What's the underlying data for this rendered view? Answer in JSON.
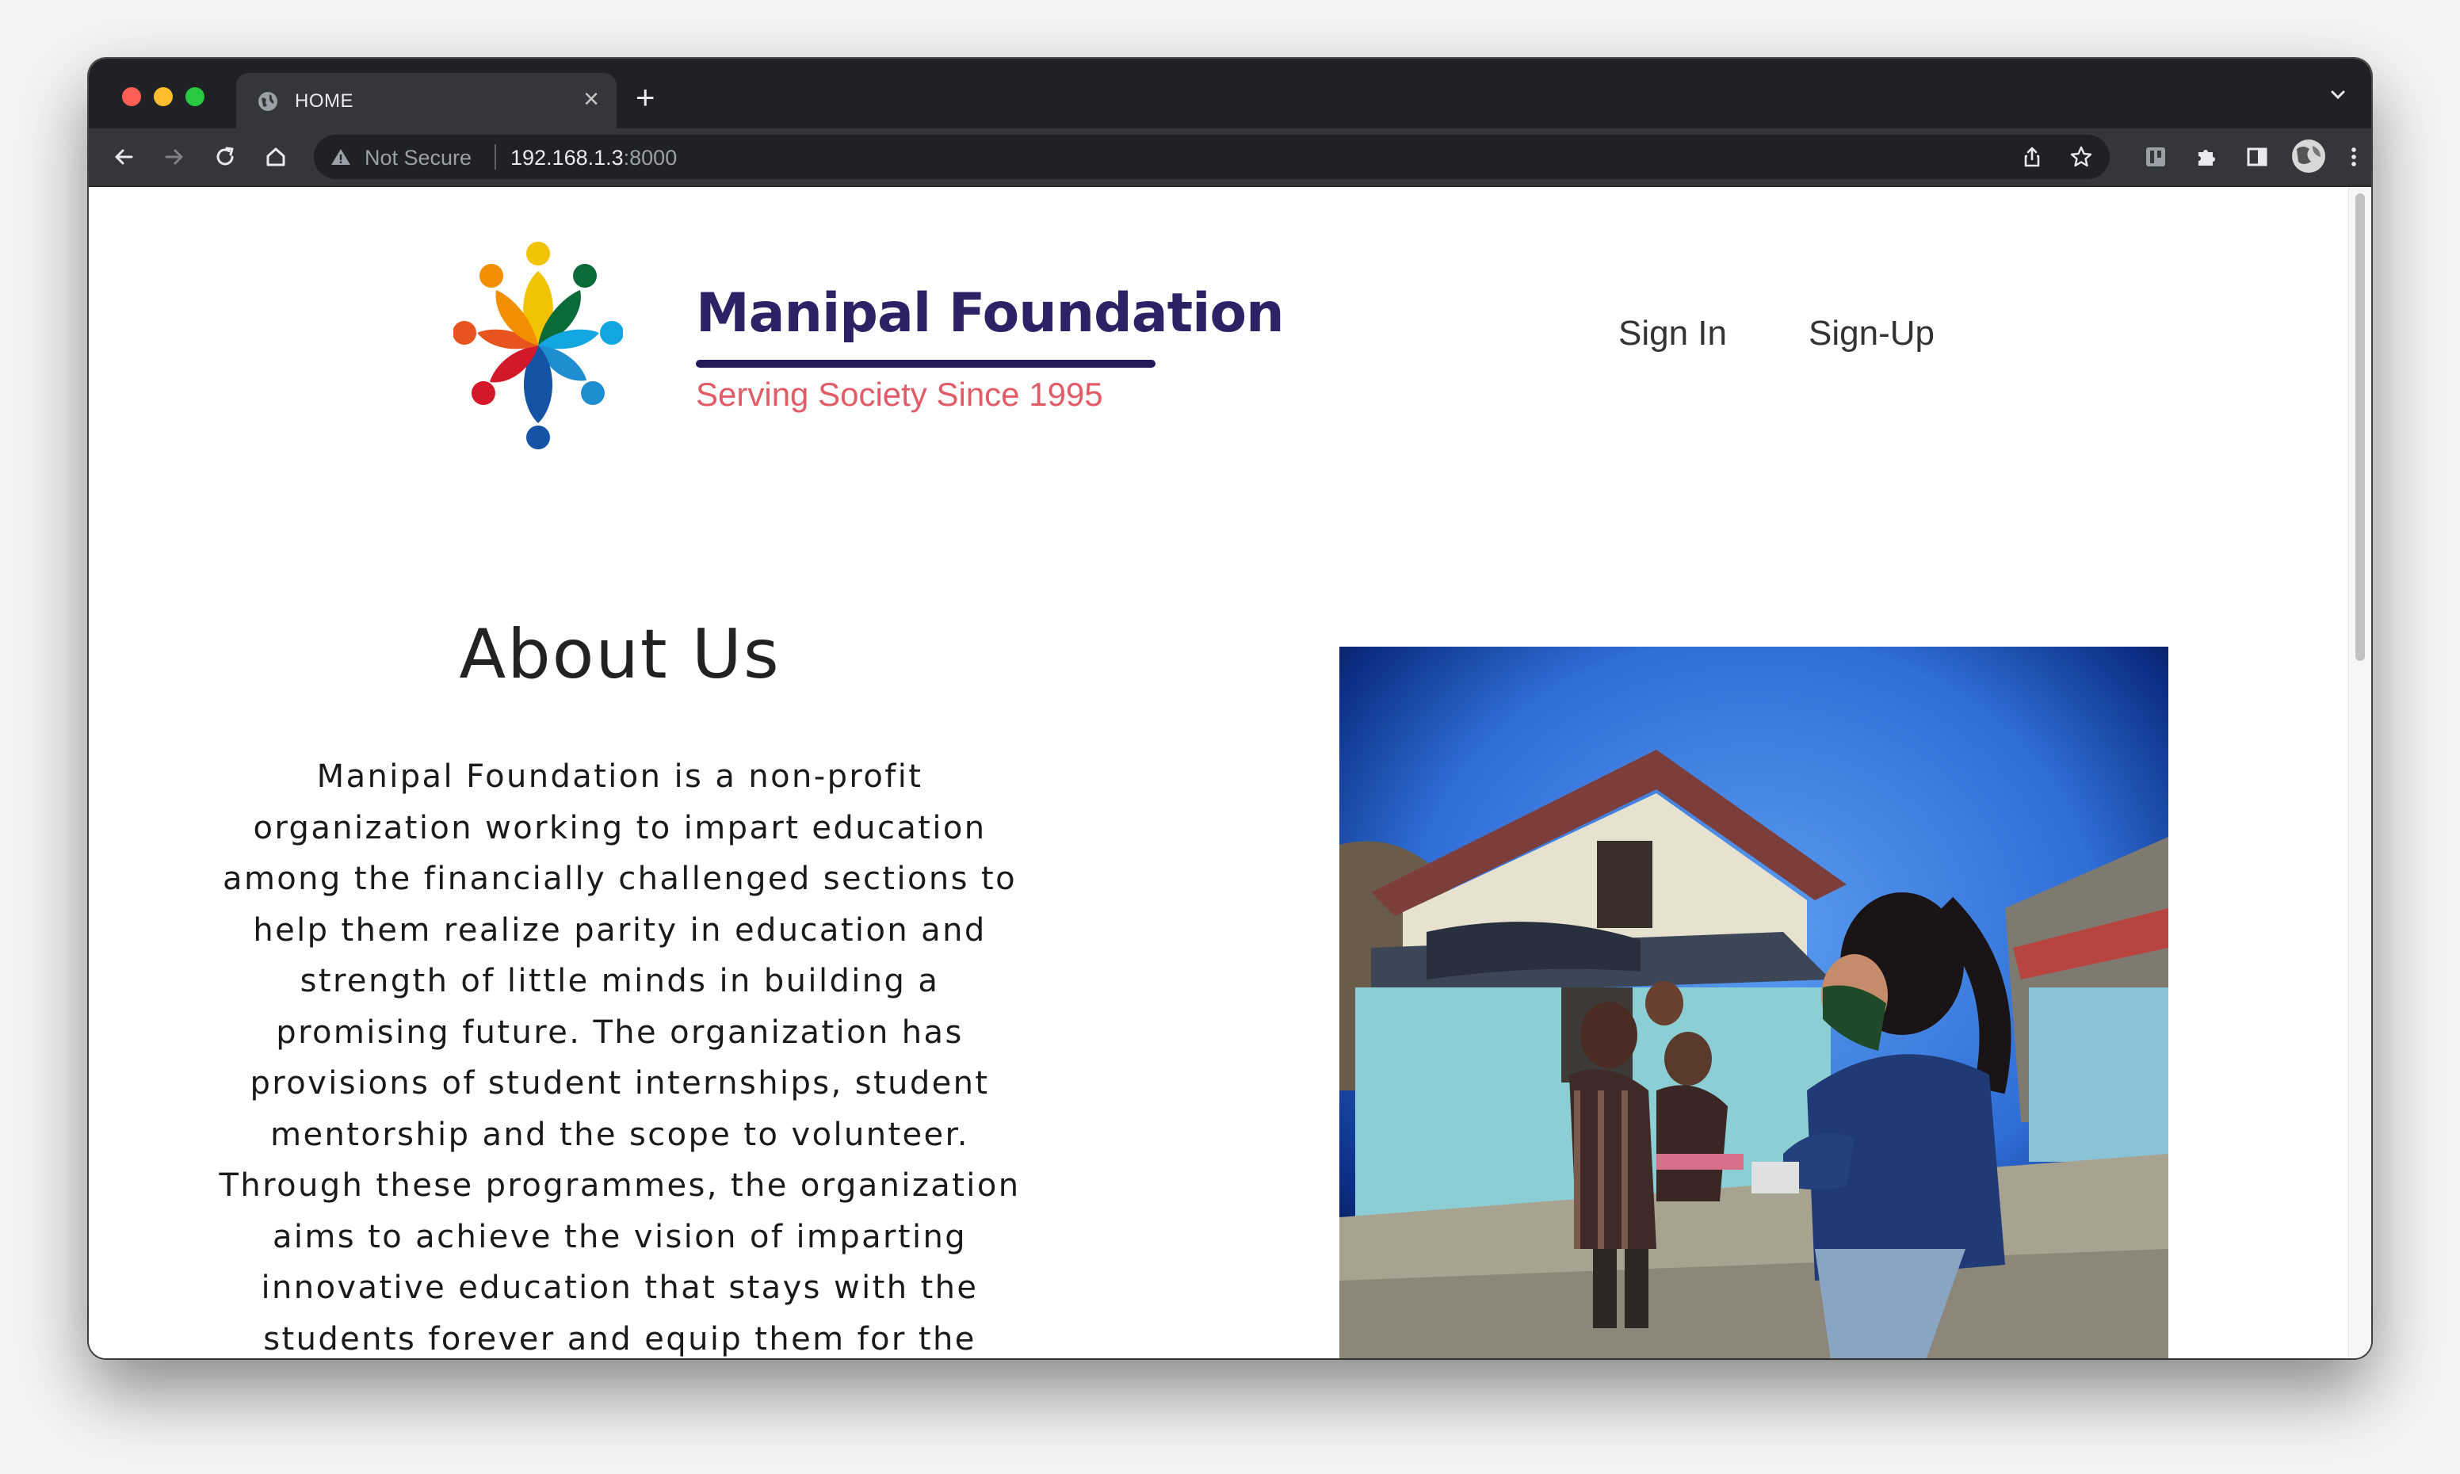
{
  "browser": {
    "tab": {
      "title": "HOME",
      "icon": "globe-icon"
    },
    "new_tab_symbol": "+",
    "close_symbol": "×",
    "address_bar": {
      "security_label": "Not Secure",
      "host": "192.168.1.3",
      "port": ":8000"
    },
    "toolbar_icons": [
      "back-icon",
      "forward-icon",
      "reload-icon",
      "home-icon",
      "share-icon",
      "bookmark-star-icon",
      "extension-tab-icon",
      "extensions-puzzle-icon",
      "side-panel-icon",
      "profile-avatar",
      "kebab-menu-icon"
    ]
  },
  "site": {
    "brand": {
      "name": "Manipal Foundation",
      "tagline": "Serving Society Since 1995"
    },
    "nav": {
      "sign_in": "Sign In",
      "sign_up": "Sign-Up"
    },
    "about": {
      "title": "About Us",
      "body": "Manipal Foundation is a non-profit organization working to impart education among the financially challenged sections to help them realize parity in education and strength of little minds in building a promising future. The organization has provisions of student internships, student mentorship and the scope to volunteer. Through these programmes, the organization aims to achieve the vision of imparting innovative education that stays with the students forever and equip them for the"
    }
  },
  "colors": {
    "brand_name": "#2f2165",
    "tagline": "#e15c66",
    "browser_chrome": "#202124",
    "toolbar": "#35363a"
  }
}
